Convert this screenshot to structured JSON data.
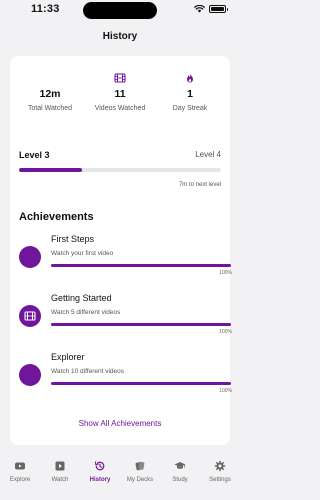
{
  "status_bar": {
    "time": "11:33"
  },
  "header": {
    "title": "History"
  },
  "stats": [
    {
      "value": "12m",
      "label": "Total Watched",
      "icon": ""
    },
    {
      "value": "11",
      "label": "Videos Watched",
      "icon": "film-icon"
    },
    {
      "value": "1",
      "label": "Day Streak",
      "icon": "flame-icon"
    }
  ],
  "level": {
    "current": "Level 3",
    "next": "Level 4",
    "progress": 0.31,
    "remaining": "7m to next level"
  },
  "achievements": {
    "title": "Achievements",
    "items": [
      {
        "name": "First Steps",
        "description": "Watch your first video",
        "progress": 1.0,
        "percent": "100%",
        "icon": ""
      },
      {
        "name": "Getting Started",
        "description": "Watch 5 different videos",
        "progress": 1.0,
        "percent": "100%",
        "icon": "film-icon"
      },
      {
        "name": "Explorer",
        "description": "Watch 10 different videos",
        "progress": 1.0,
        "percent": "100%",
        "icon": ""
      }
    ],
    "show_all": "Show All Achievements"
  },
  "tabbar": {
    "tabs": [
      {
        "label": "Explore",
        "icon": "play-rect-icon",
        "active": false
      },
      {
        "label": "Watch",
        "icon": "play-square-icon",
        "active": false
      },
      {
        "label": "History",
        "icon": "history-icon",
        "active": true
      },
      {
        "label": "My Decks",
        "icon": "cards-icon",
        "active": false
      },
      {
        "label": "Study",
        "icon": "graduation-cap-icon",
        "active": false
      },
      {
        "label": "Settings",
        "icon": "gear-icon",
        "active": false
      }
    ]
  },
  "colors": {
    "accent": "#6f169a",
    "track": "#e6e6e9",
    "background": "#f2f2f5",
    "card": "#ffffff"
  }
}
